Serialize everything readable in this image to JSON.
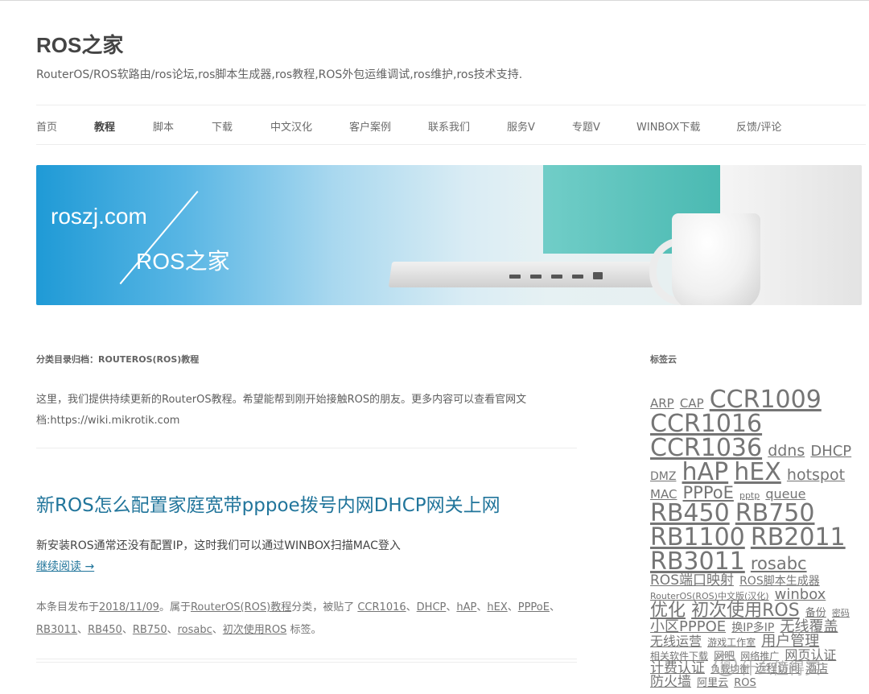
{
  "site": {
    "title": "ROS之家",
    "description": "RouterOS/ROS软路由/ros论坛,ros脚本生成器,ros教程,ROS外包运维调试,ros维护,ros技术支持."
  },
  "nav": {
    "items": [
      {
        "label": "首页"
      },
      {
        "label": "教程",
        "active": true
      },
      {
        "label": "脚本"
      },
      {
        "label": "下载"
      },
      {
        "label": "中文汉化"
      },
      {
        "label": "客户案例"
      },
      {
        "label": "联系我们"
      },
      {
        "label": "服务V"
      },
      {
        "label": "专题V"
      },
      {
        "label": "WINBOX下载"
      },
      {
        "label": "反馈/评论"
      }
    ]
  },
  "banner": {
    "text1": "roszj.com",
    "text2": "ROS之家"
  },
  "archive": {
    "title": "分类目录归档：ROUTEROS(ROS)教程",
    "description": "这里，我们提供持续更新的RouterOS教程。希望能帮到刚开始接触ROS的朋友。更多内容可以查看官网文档:https://wiki.mikrotik.com"
  },
  "post": {
    "title": "新ROS怎么配置家庭宽带pppoe拨号内网DHCP网关上网",
    "excerpt": "新安装ROS通常还没有配置IP，这时我们可以通过WINBOX扫描MAC登入",
    "more_link": "继续阅读 →",
    "meta": {
      "prefix": "本条目发布于",
      "date": "2018/11/09",
      "mid1": "。属于",
      "category": "RouterOS(ROS)教程",
      "mid2": "分类，被贴了",
      "tags": [
        "CCR1016",
        "DHCP",
        "hAP",
        "hEX",
        "PPPoE",
        "RB3011",
        "RB450",
        "RB750",
        "rosabc",
        "初次使用ROS"
      ],
      "suffix": "标签。"
    }
  },
  "sidebar": {
    "tagcloud_title": "标签云",
    "tags": [
      {
        "label": "ARP",
        "size": 15
      },
      {
        "label": "CAP",
        "size": 15
      },
      {
        "label": "CCR1009",
        "size": 30
      },
      {
        "label": "CCR1016",
        "size": 30
      },
      {
        "label": "CCR1036",
        "size": 30
      },
      {
        "label": "ddns",
        "size": 19
      },
      {
        "label": "DHCP",
        "size": 18
      },
      {
        "label": "DMZ",
        "size": 14
      },
      {
        "label": "hAP",
        "size": 30
      },
      {
        "label": "hEX",
        "size": 30
      },
      {
        "label": "hotspot",
        "size": 19
      },
      {
        "label": "MAC",
        "size": 15
      },
      {
        "label": "PPPoE",
        "size": 21
      },
      {
        "label": "pptp",
        "size": 11
      },
      {
        "label": "queue",
        "size": 16
      },
      {
        "label": "RB450",
        "size": 30
      },
      {
        "label": "RB750",
        "size": 30
      },
      {
        "label": "RB1100",
        "size": 30
      },
      {
        "label": "RB2011",
        "size": 30
      },
      {
        "label": "RB3011",
        "size": 30
      },
      {
        "label": "rosabc",
        "size": 21
      },
      {
        "label": "ROS端口映射",
        "size": 17
      },
      {
        "label": "ROS脚本生成器",
        "size": 14
      },
      {
        "label": "RouterOS(ROS)中文版(汉化)",
        "size": 11
      },
      {
        "label": "winbox",
        "size": 18
      },
      {
        "label": "优化",
        "size": 22
      },
      {
        "label": "初次使用ROS",
        "size": 22
      },
      {
        "label": "备份",
        "size": 13
      },
      {
        "label": "密码",
        "size": 11
      },
      {
        "label": "小区PPPOE",
        "size": 18
      },
      {
        "label": "换IP多IP",
        "size": 14
      },
      {
        "label": "无线覆盖",
        "size": 18
      },
      {
        "label": "无线运营",
        "size": 16
      },
      {
        "label": "游戏工作室",
        "size": 12
      },
      {
        "label": "用户管理",
        "size": 18
      },
      {
        "label": "相关软件下载",
        "size": 12
      },
      {
        "label": "网吧",
        "size": 13
      },
      {
        "label": "网络推广",
        "size": 12
      },
      {
        "label": "网页认证",
        "size": 16
      },
      {
        "label": "计费认证",
        "size": 17
      },
      {
        "label": "负载均衡",
        "size": 12
      },
      {
        "label": "远程访问",
        "size": 14
      },
      {
        "label": "酒店",
        "size": 14
      },
      {
        "label": "防火墙",
        "size": 17
      },
      {
        "label": "阿里云",
        "size": 13
      },
      {
        "label": "ROS",
        "size": 13
      }
    ]
  },
  "watermark": {
    "icon": "值",
    "text": "什么值得买"
  }
}
